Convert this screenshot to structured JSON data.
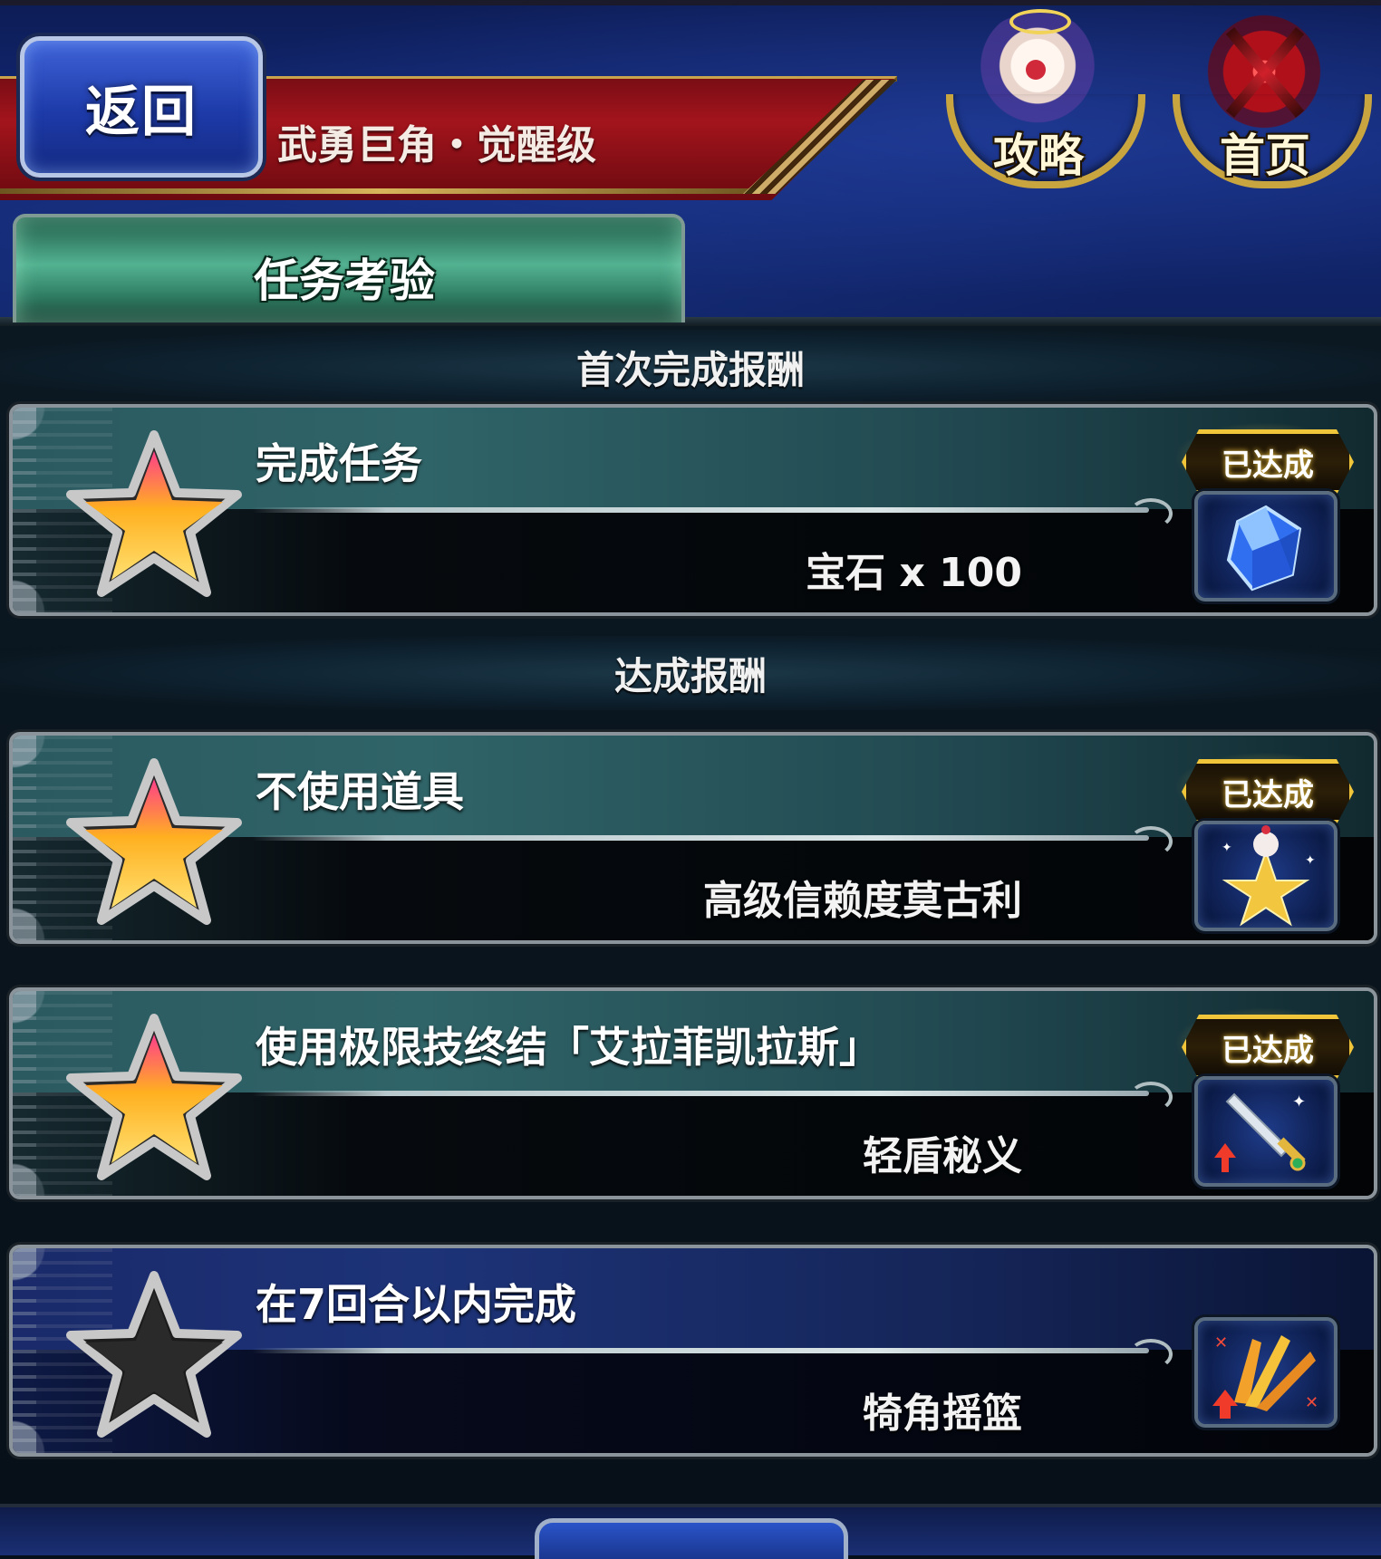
{
  "header": {
    "back_label": "返回",
    "title": "武勇巨角・觉醒级",
    "strategy_label": "攻略",
    "home_label": "首页"
  },
  "tabs": [
    {
      "label": "任务考验",
      "selected": true
    }
  ],
  "sections": {
    "first_reward": "首次完成报酬",
    "achievement_reward": "达成报酬"
  },
  "missions": [
    {
      "title": "完成任务",
      "reward": "宝石 x 100",
      "achieved": true,
      "badge": "已达成",
      "icon": "gem-icon"
    },
    {
      "title": "不使用道具",
      "reward": "高级信赖度莫古利",
      "achieved": true,
      "badge": "已达成",
      "icon": "moogle-star-icon"
    },
    {
      "title": "使用极限技终结「艾拉菲凯拉斯」",
      "reward": "轻盾秘义",
      "achieved": true,
      "badge": "已达成",
      "icon": "sword-boost-icon"
    },
    {
      "title": "在7回合以内完成",
      "reward": "犄角摇篮",
      "achieved": false,
      "badge": "",
      "icon": "burst-boost-icon"
    }
  ],
  "colors": {
    "header_blue": "#132a78",
    "ribbon_red": "#a3141c",
    "tab_green": "#53b291",
    "badge_gold": "#f0c53a",
    "star_achieved": "#ffb020",
    "star_unachieved": "#2a2a2a"
  }
}
